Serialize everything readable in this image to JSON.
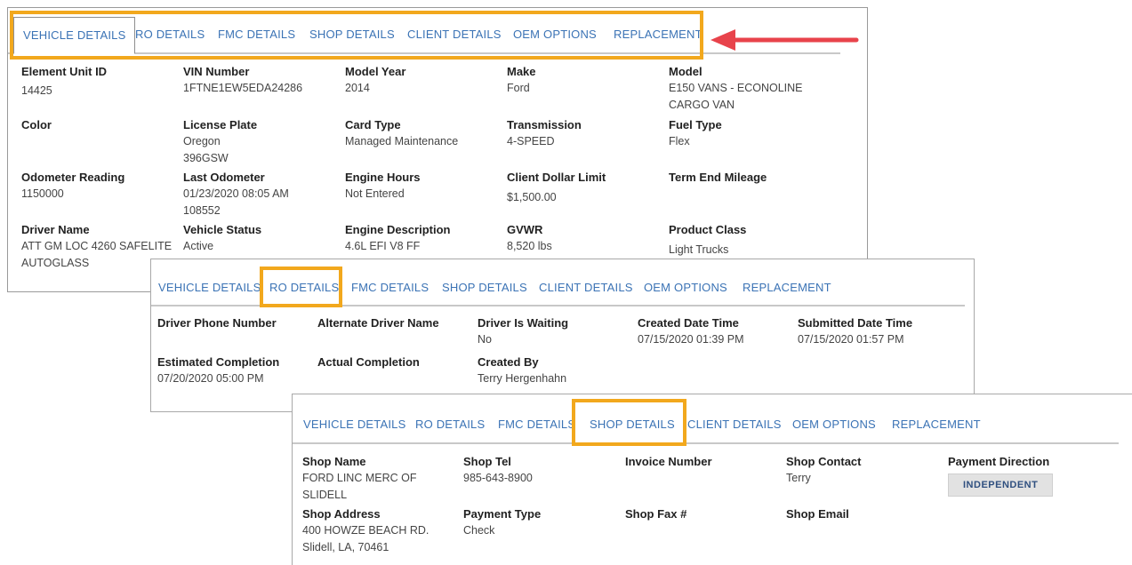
{
  "tabs": [
    "VEHICLE DETAILS",
    "RO DETAILS",
    "FMC DETAILS",
    "SHOP DETAILS",
    "CLIENT DETAILS",
    "OEM OPTIONS",
    "REPLACEMENT"
  ],
  "vehicle": {
    "element_unit_id": {
      "label": "Element Unit ID",
      "value": "14425"
    },
    "vin": {
      "label": "VIN Number",
      "value": "1FTNE1EW5EDA24286"
    },
    "model_year": {
      "label": "Model Year",
      "value": "2014"
    },
    "make": {
      "label": "Make",
      "value": "Ford"
    },
    "model": {
      "label": "Model",
      "value1": "E150 VANS - ECONOLINE",
      "value2": "CARGO VAN"
    },
    "color": {
      "label": "Color",
      "value": ""
    },
    "license_plate": {
      "label": "License Plate",
      "value1": "Oregon",
      "value2": "396GSW"
    },
    "card_type": {
      "label": "Card Type",
      "value": "Managed Maintenance"
    },
    "transmission": {
      "label": "Transmission",
      "value": "4-SPEED"
    },
    "fuel_type": {
      "label": "Fuel Type",
      "value": "Flex"
    },
    "odometer": {
      "label": "Odometer Reading",
      "value": "1150000"
    },
    "last_odometer": {
      "label": "Last Odometer",
      "value1": "01/23/2020 08:05 AM",
      "value2": "108552"
    },
    "engine_hours": {
      "label": "Engine Hours",
      "value": "Not Entered"
    },
    "client_dollar_limit": {
      "label": "Client Dollar Limit",
      "value": "$1,500.00"
    },
    "term_end_mileage": {
      "label": "Term End Mileage",
      "value": ""
    },
    "driver_name": {
      "label": "Driver Name",
      "value1": "ATT GM LOC 4260 SAFELITE",
      "value2": "AUTOGLASS"
    },
    "vehicle_status": {
      "label": "Vehicle Status",
      "value": "Active"
    },
    "engine_description": {
      "label": "Engine Description",
      "value": "4.6L EFI V8 FF"
    },
    "gvwr": {
      "label": "GVWR",
      "value": "8,520 lbs"
    },
    "product_class": {
      "label": "Product Class",
      "value": "Light Trucks"
    }
  },
  "ro": {
    "driver_phone": {
      "label": "Driver Phone Number",
      "value": ""
    },
    "alternate_driver": {
      "label": "Alternate Driver Name",
      "value": ""
    },
    "driver_waiting": {
      "label": "Driver Is Waiting",
      "value": "No"
    },
    "created_date": {
      "label": "Created Date Time",
      "value": "07/15/2020 01:39 PM"
    },
    "submitted_date": {
      "label": "Submitted Date Time",
      "value": "07/15/2020 01:57 PM"
    },
    "estimated_completion": {
      "label": "Estimated Completion",
      "value": "07/20/2020 05:00 PM"
    },
    "actual_completion": {
      "label": "Actual Completion",
      "value": ""
    },
    "created_by": {
      "label": "Created By",
      "value": "Terry Hergenhahn"
    }
  },
  "shop": {
    "shop_name": {
      "label": "Shop Name",
      "value1": "FORD LINC MERC OF",
      "value2": "SLIDELL"
    },
    "shop_tel": {
      "label": "Shop Tel",
      "value": "985-643-8900"
    },
    "invoice_number": {
      "label": "Invoice Number",
      "value": ""
    },
    "shop_contact": {
      "label": "Shop Contact",
      "value": "Terry"
    },
    "payment_direction": {
      "label": "Payment Direction",
      "value": "INDEPENDENT"
    },
    "shop_address": {
      "label": "Shop Address",
      "value1": "400 HOWZE BEACH RD.",
      "value2": "Slidell, LA, 70461"
    },
    "payment_type": {
      "label": "Payment Type",
      "value": "Check"
    },
    "shop_fax": {
      "label": "Shop Fax #",
      "value": ""
    },
    "shop_email": {
      "label": "Shop Email",
      "value": ""
    }
  },
  "colors": {
    "highlight": "#f2a81d",
    "arrow": "#e8434b",
    "tab_text": "#3b73b5"
  }
}
